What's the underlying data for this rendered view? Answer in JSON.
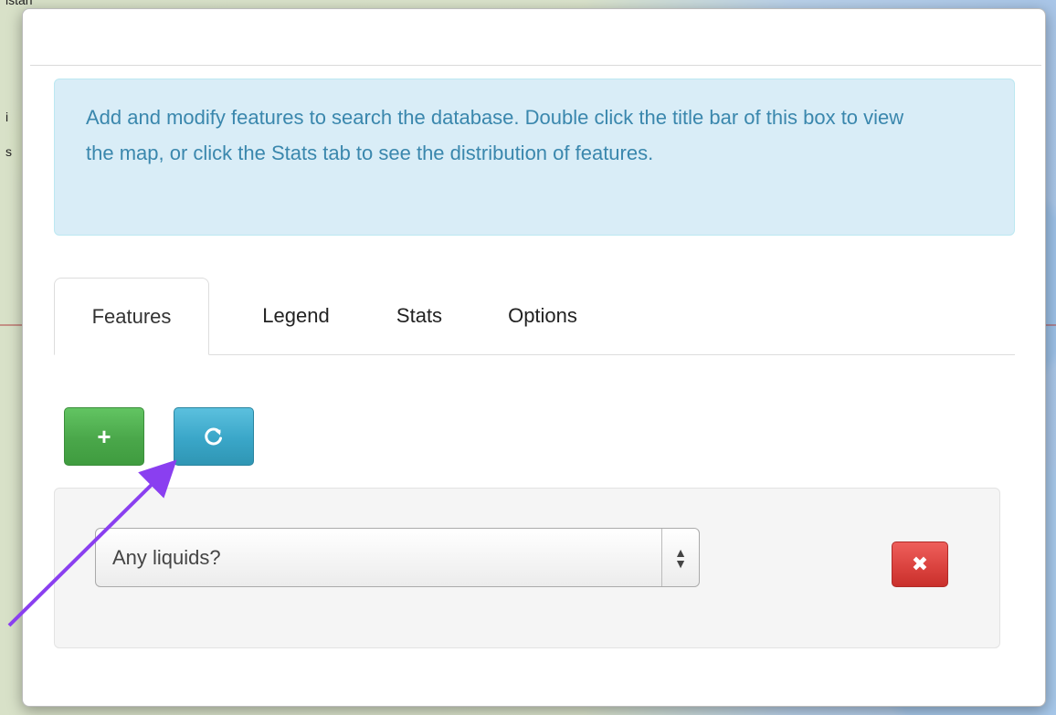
{
  "background": {
    "map_labels": [
      "istan",
      "i",
      "s"
    ]
  },
  "info": {
    "text": "Add and modify features to search the database. Double click the title bar of this box to view the map, or click the Stats tab to see the distribution of features."
  },
  "tabs": [
    {
      "label": "Features",
      "active": true
    },
    {
      "label": "Legend",
      "active": false
    },
    {
      "label": "Stats",
      "active": false
    },
    {
      "label": "Options",
      "active": false
    }
  ],
  "buttons": {
    "add_icon": "plus-icon",
    "add_glyph": "+",
    "refresh_icon": "refresh-icon",
    "refresh_glyph": "C",
    "delete_icon": "close-icon",
    "delete_glyph": "✖"
  },
  "feature_row": {
    "selected_value": "Any liquids?",
    "select_arrows_up": "▲",
    "select_arrows_down": "▼"
  },
  "colors": {
    "info_bg": "#d9edf7",
    "info_text": "#3a87ad",
    "add_button": "#5bb75b",
    "refresh_button": "#49afcd",
    "delete_button": "#da4f49",
    "annotation_arrow": "#8a3ff0"
  }
}
